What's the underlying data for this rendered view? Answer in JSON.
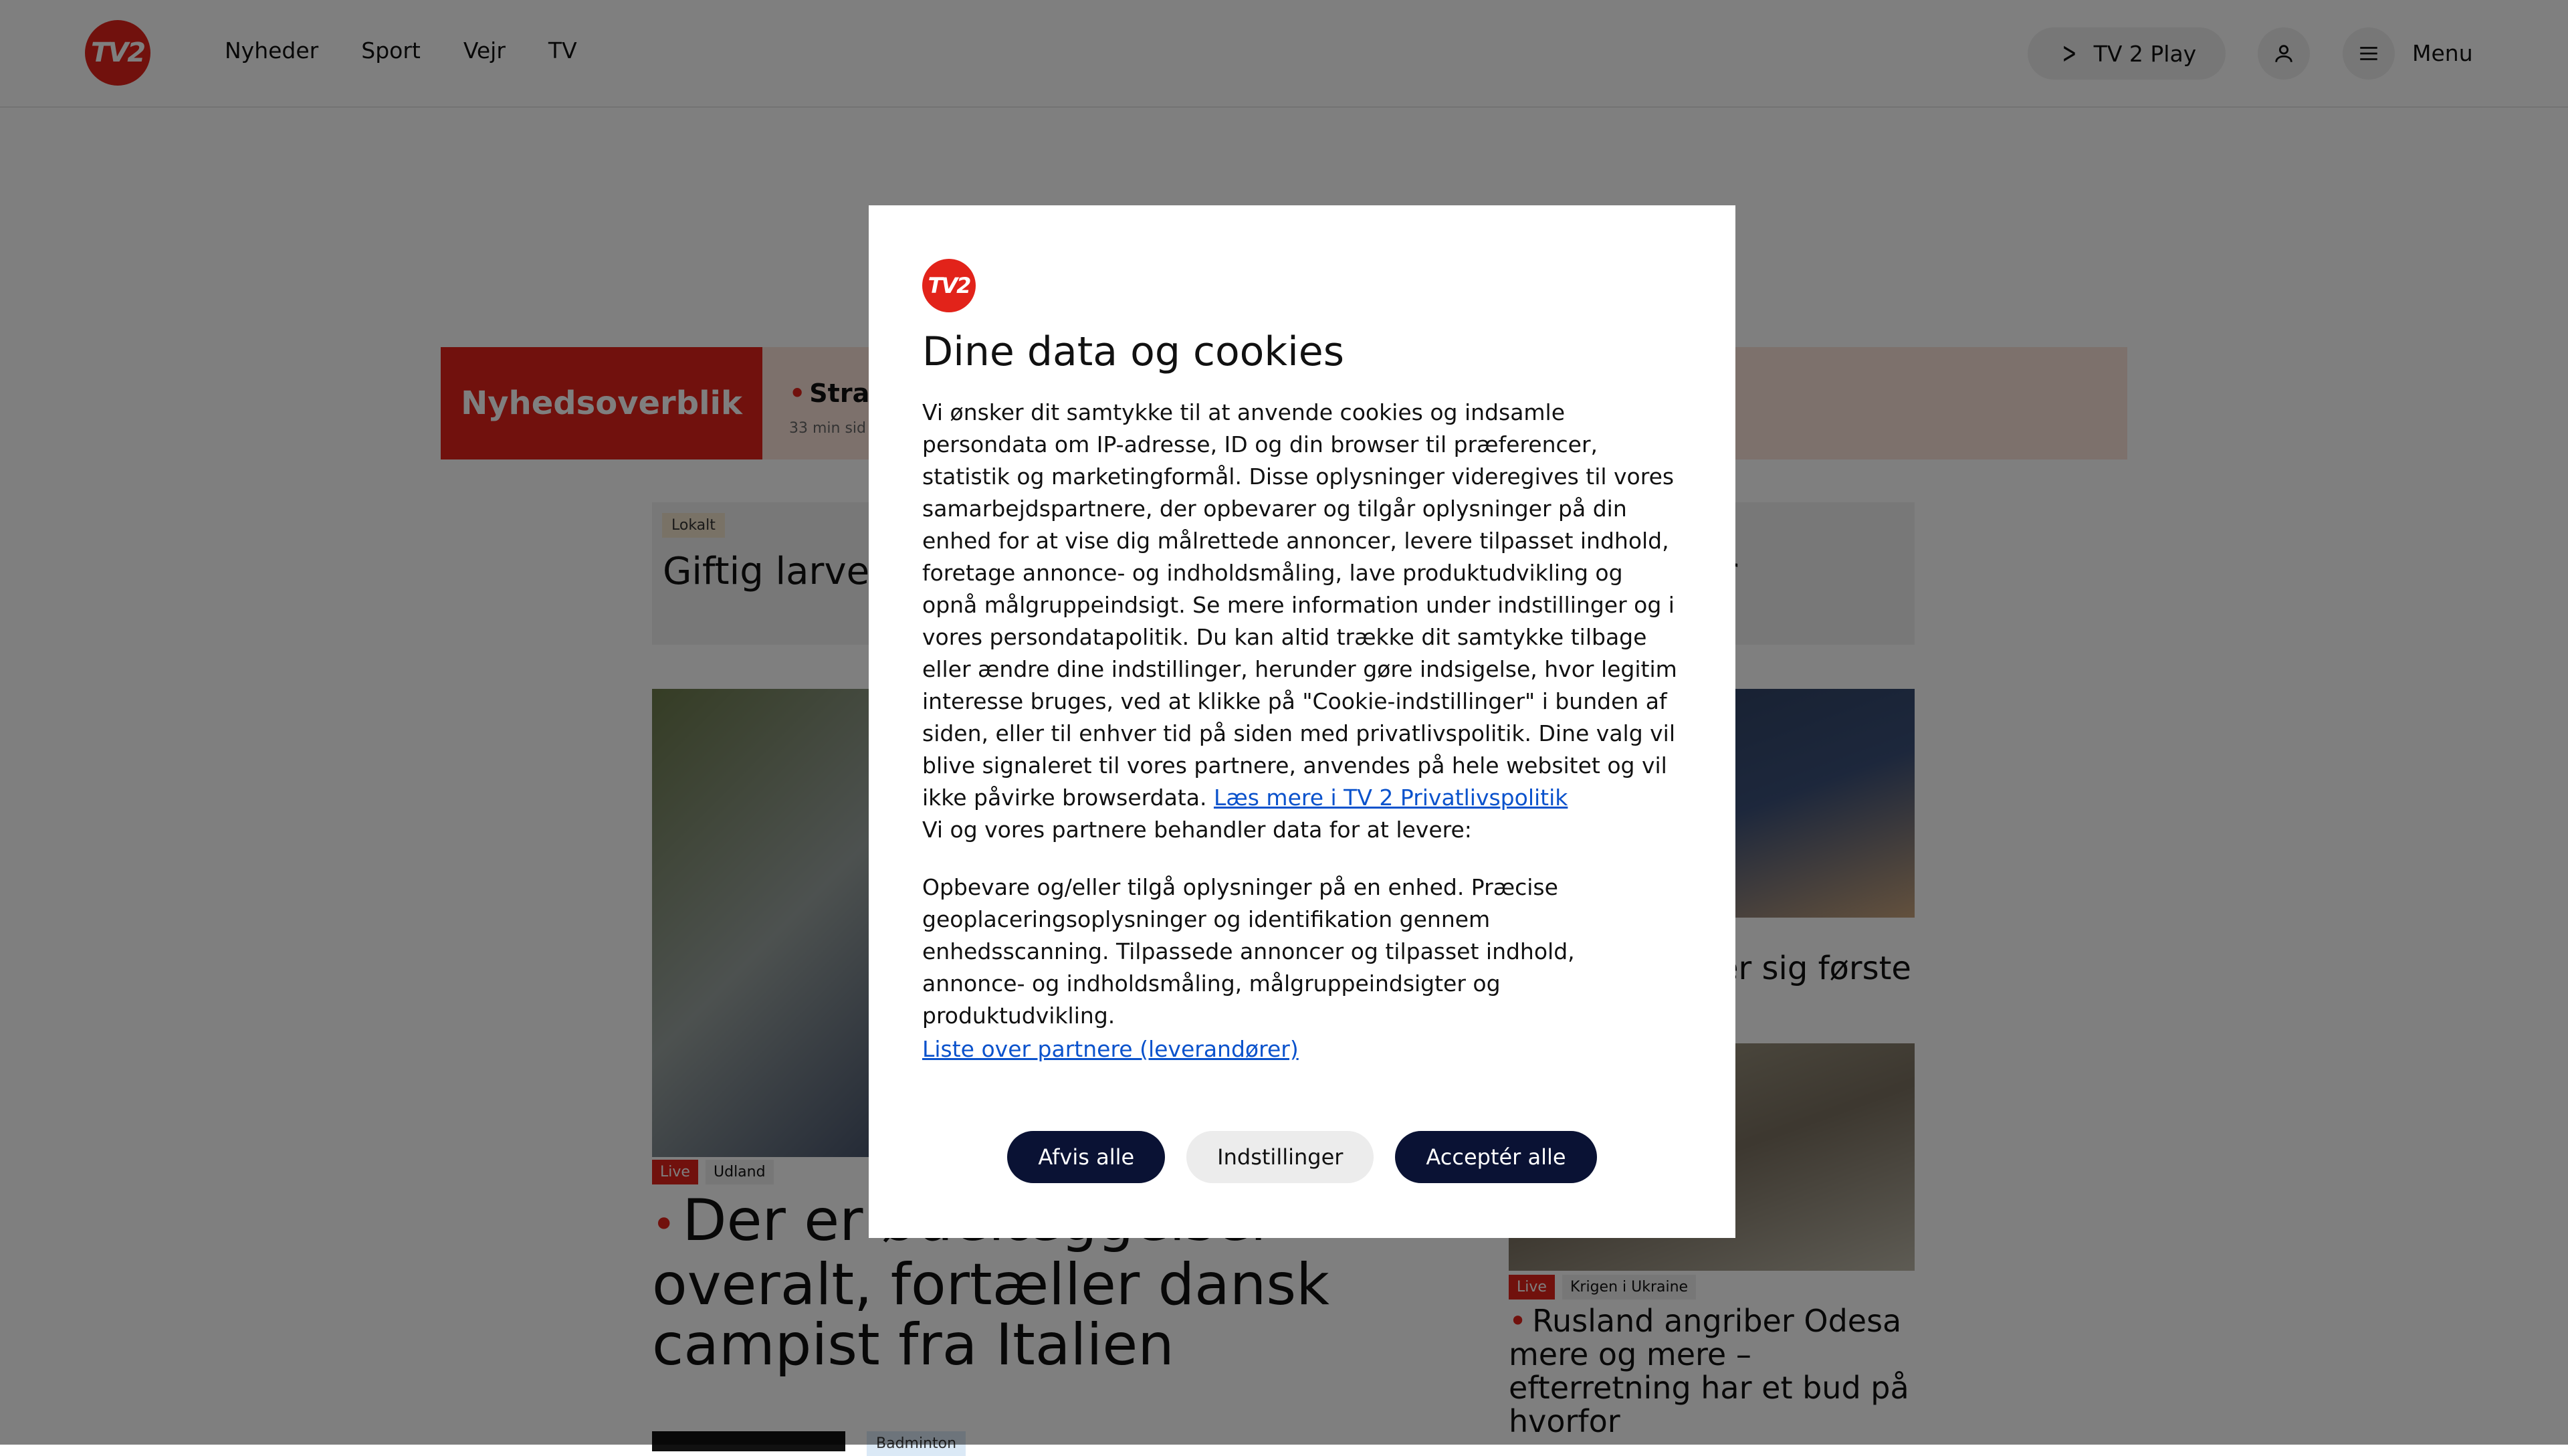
{
  "header": {
    "logo_text": "TV2",
    "nav": [
      "Nyheder",
      "Sport",
      "Vejr",
      "TV"
    ],
    "play_label": "TV 2 Play",
    "menu_label": "Menu"
  },
  "overview": {
    "title": "Nyhedsoverblik",
    "item": "Stran",
    "time": "33 min sid"
  },
  "articles": {
    "local_tag": "Lokalt",
    "local_title": "Giftig larve strand",
    "card2_title_fragment": "fter",
    "main_live": "Live",
    "main_category": "Udland",
    "main_headline": "Der er ødelæggelser overalt, fortæller dansk campist fra Italien",
    "right1_fragment": "er sig første",
    "right2_live": "Live",
    "right2_category": "Krigen i Ukraine",
    "right2_headline": "Rusland angriber Odesa mere og mere – efterretning har et bud på hvorfor",
    "bottom_tag": "Badminton"
  },
  "dialog": {
    "logo_text": "TV2",
    "title": "Dine data og cookies",
    "body": "Vi ønsker dit samtykke til at anvende cookies og indsamle persondata om IP-adresse, ID og din browser til præferencer, statistik og marketingformål. Disse oplysninger videregives til vores samarbejdspartnere, der opbevarer og tilgår oplysninger på din enhed for at vise dig målrettede annoncer, levere tilpasset indhold, foretage annonce- og indholdsmåling, lave produktudvikling og opnå målgruppeindsigt. Se mere information under indstillinger og i vores persondatapolitik. Du kan altid trække dit samtykke tilbage eller ændre dine indstillinger, herunder gøre indsigelse, hvor legitim interesse bruges, ved at klikke på \"Cookie-indstillinger\" i bunden af siden, eller til enhver tid på siden med privatlivspolitik. Dine valg vil blive signaleret til vores partnere, anvendes på hele websitet og vil ikke påvirke browserdata.",
    "privacy_link": "Læs mere i TV 2 Privatlivspolitik",
    "partners_intro": "Vi og vores partnere behandler data for at levere:",
    "purposes": "Opbevare og/eller tilgå oplysninger på en enhed. Præcise geoplaceringsoplysninger og identifikation gennem enhedsscanning. Tilpassede annoncer og tilpasset indhold, annonce- og indholdsmåling, målgruppeindsigter og produktudvikling.",
    "partners_link": "Liste over partnere (leverandører)",
    "buttons": {
      "reject": "Afvis alle",
      "settings": "Indstillinger",
      "accept": "Acceptér alle"
    }
  }
}
